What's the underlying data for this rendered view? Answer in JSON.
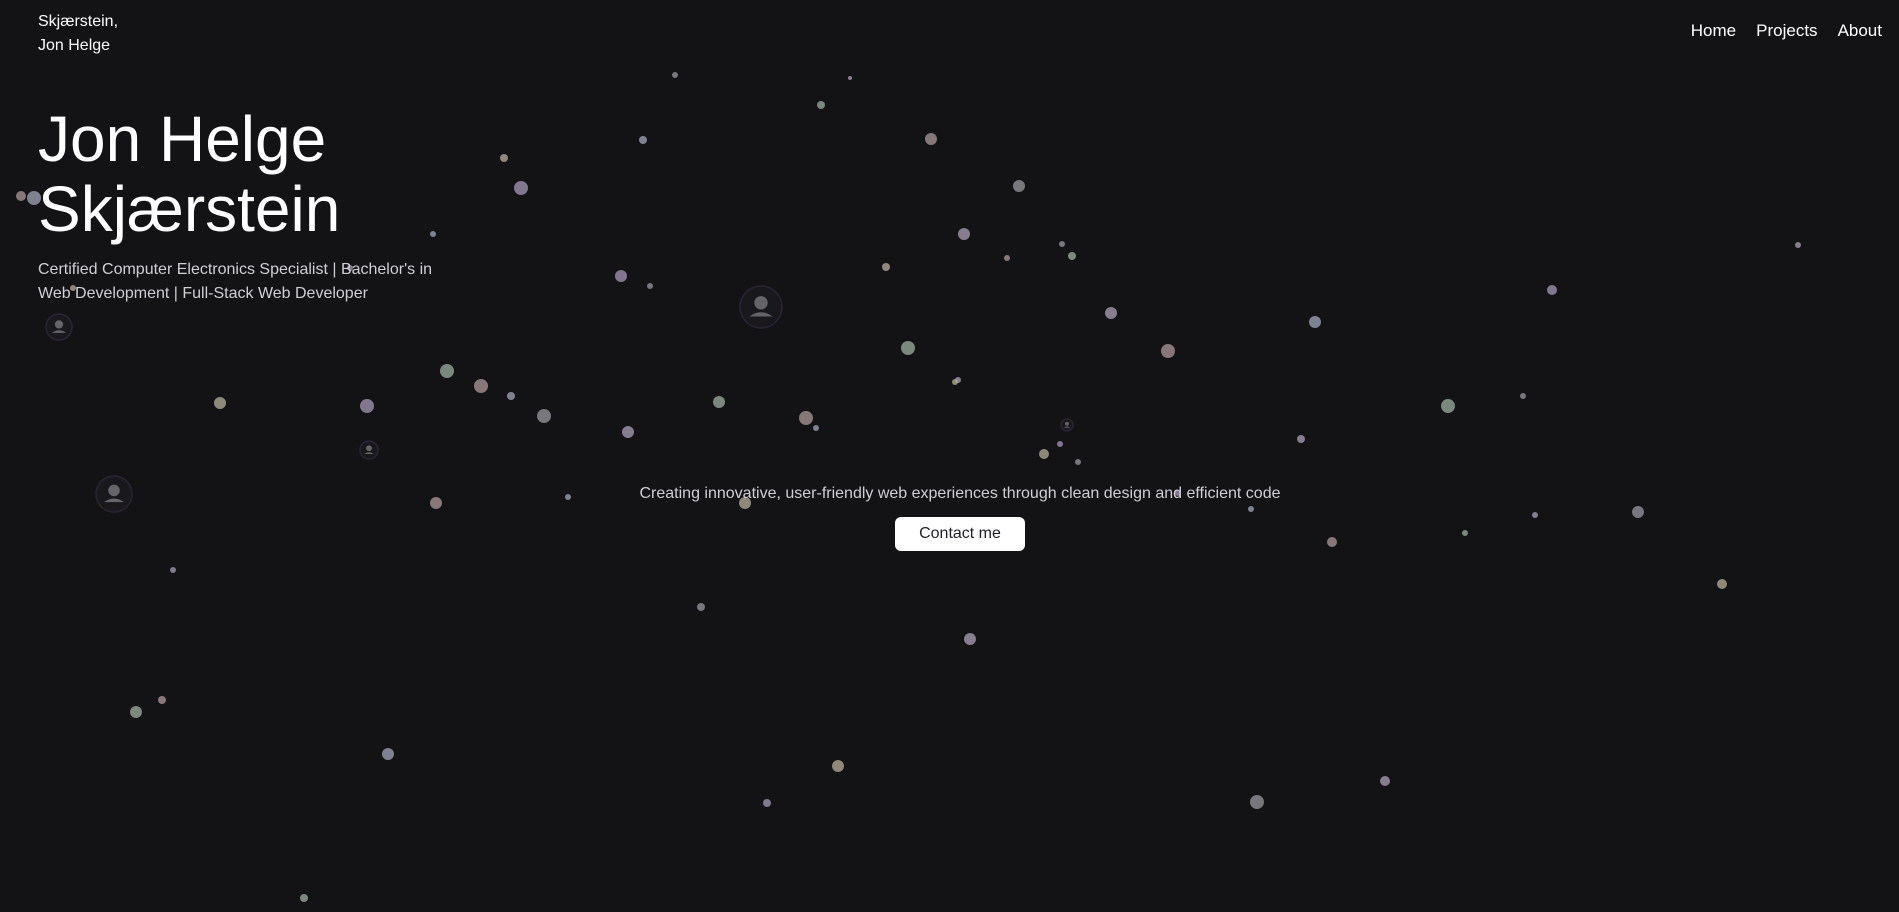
{
  "header": {
    "brand_line1": "Skjærstein,",
    "brand_line2": "Jon Helge",
    "nav": [
      {
        "label": "Home"
      },
      {
        "label": "Projects"
      },
      {
        "label": "About"
      }
    ]
  },
  "hero": {
    "title_line1": "Jon Helge",
    "title_line2": "Skjærstein",
    "subtitle": "Certified Computer Electronics Specialist | Bachelor's in Web Development | Full-Stack Web Developer"
  },
  "main": {
    "tagline": "Creating innovative, user-friendly web experiences through clean design and efficient code",
    "contact_label": "Contact me"
  },
  "colors": {
    "background": "#131316",
    "text": "#ffffff",
    "muted_text": "#cfcfd4",
    "button_bg": "#ffffff",
    "button_text": "#222226"
  },
  "particles": {
    "count": 80,
    "palette": [
      "#9a9aa0",
      "#b0a0b8",
      "#9fb0a0",
      "#b09a9a",
      "#a0a8b8",
      "#b8b09a",
      "#a89ab8"
    ],
    "avatars": 5
  }
}
